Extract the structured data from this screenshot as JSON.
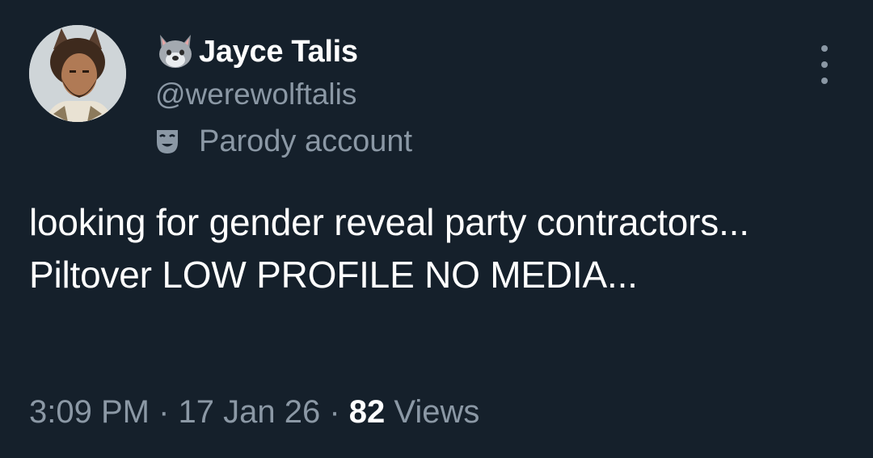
{
  "author": {
    "display_name": "Jayce Talis",
    "name_emoji_icon": "wolf-face-icon",
    "handle": "@werewolftalis",
    "label_icon": "theater-mask-icon",
    "label": "Parody account",
    "avatar_icon": "bearded-man-wolf-ears-avatar"
  },
  "menu": {
    "icon": "more-vertical-icon"
  },
  "tweet": {
    "text": "looking for gender reveal party contractors... Piltover LOW PROFILE NO MEDIA..."
  },
  "meta": {
    "time": "3:09 PM",
    "separator": " · ",
    "date": "17 Jan 26",
    "views_count": "82",
    "views_label": " Views"
  },
  "colors": {
    "background": "#15202b",
    "primary_text": "#ffffff",
    "secondary_text": "#8b98a5"
  }
}
